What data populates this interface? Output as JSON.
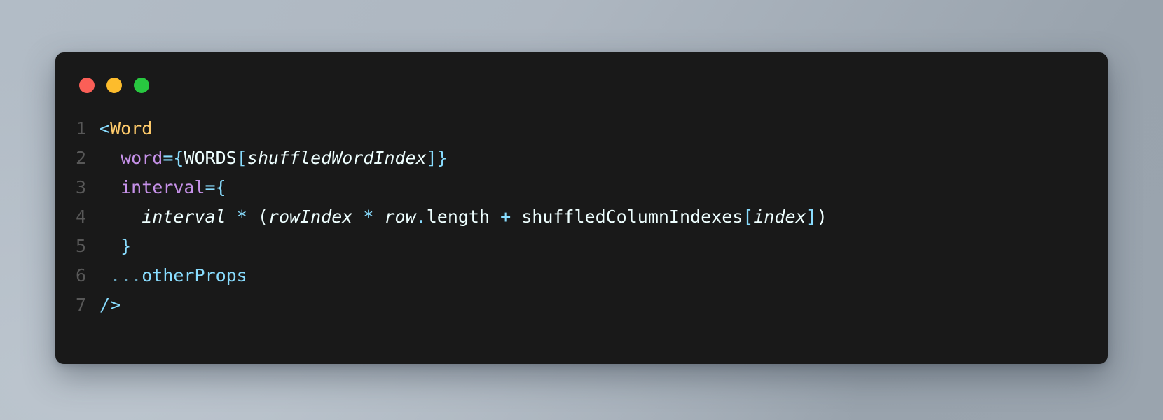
{
  "window": {
    "background_color": "#191919",
    "page_background_color": "#aeb7c1",
    "traffic_lights": [
      {
        "name": "close",
        "color": "#fb5f57"
      },
      {
        "name": "minimize",
        "color": "#fdbc2c"
      },
      {
        "name": "maximize",
        "color": "#28c840"
      }
    ]
  },
  "palette": {
    "tag": "#ffcb6b",
    "attribute": "#c792ea",
    "punctuation": "#89ddff",
    "plain": "#eeffff",
    "line_number": "#585858"
  },
  "editor": {
    "language": "jsx",
    "line_numbers": [
      "1",
      "2",
      "3",
      "4",
      "5",
      "6",
      "7"
    ],
    "lines": [
      {
        "number": "1",
        "text": "<Word",
        "tokens": [
          {
            "t": "<",
            "c": "punct"
          },
          {
            "t": "Word",
            "c": "tag"
          }
        ]
      },
      {
        "number": "2",
        "text": "  word={WORDS[shuffledWordIndex]}",
        "tokens": [
          {
            "t": "  ",
            "c": "plain"
          },
          {
            "t": "word",
            "c": "attr"
          },
          {
            "t": "=",
            "c": "op"
          },
          {
            "t": "{",
            "c": "punct"
          },
          {
            "t": "WORDS",
            "c": "plain"
          },
          {
            "t": "[",
            "c": "punct"
          },
          {
            "t": "shuffledWordIndex",
            "c": "var"
          },
          {
            "t": "]",
            "c": "punct"
          },
          {
            "t": "}",
            "c": "punct"
          }
        ]
      },
      {
        "number": "3",
        "text": "  interval={",
        "tokens": [
          {
            "t": "  ",
            "c": "plain"
          },
          {
            "t": "interval",
            "c": "attr"
          },
          {
            "t": "=",
            "c": "op"
          },
          {
            "t": "{",
            "c": "punct"
          }
        ]
      },
      {
        "number": "4",
        "text": "    interval * (rowIndex * row.length + shuffledColumnIndexes[index])",
        "tokens": [
          {
            "t": "    ",
            "c": "plain"
          },
          {
            "t": "interval",
            "c": "var"
          },
          {
            "t": " ",
            "c": "plain"
          },
          {
            "t": "*",
            "c": "op"
          },
          {
            "t": " ",
            "c": "plain"
          },
          {
            "t": "(",
            "c": "plain"
          },
          {
            "t": "rowIndex",
            "c": "var"
          },
          {
            "t": " ",
            "c": "plain"
          },
          {
            "t": "*",
            "c": "op"
          },
          {
            "t": " ",
            "c": "plain"
          },
          {
            "t": "row",
            "c": "var"
          },
          {
            "t": ".",
            "c": "op"
          },
          {
            "t": "length",
            "c": "plain"
          },
          {
            "t": " ",
            "c": "plain"
          },
          {
            "t": "+",
            "c": "op"
          },
          {
            "t": " ",
            "c": "plain"
          },
          {
            "t": "shuffledColumnIndexes",
            "c": "plain"
          },
          {
            "t": "[",
            "c": "punct"
          },
          {
            "t": "index",
            "c": "var"
          },
          {
            "t": "]",
            "c": "punct"
          },
          {
            "t": ")",
            "c": "plain"
          }
        ]
      },
      {
        "number": "5",
        "text": "  }",
        "tokens": [
          {
            "t": "  ",
            "c": "plain"
          },
          {
            "t": "}",
            "c": "punct"
          }
        ]
      },
      {
        "number": "6",
        "text": "  ...otherProps",
        "tokens": [
          {
            "t": " ",
            "c": "plain"
          },
          {
            "t": "...",
            "c": "spread"
          },
          {
            "t": "otherProps",
            "c": "prop"
          }
        ]
      },
      {
        "number": "7",
        "text": "/>",
        "tokens": [
          {
            "t": "/>",
            "c": "punct"
          }
        ]
      }
    ]
  }
}
